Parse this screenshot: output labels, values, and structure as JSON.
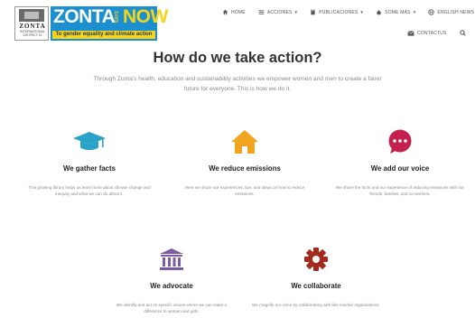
{
  "logo": {
    "org": "ZONTA",
    "sub": "INTERNATIONAL DISTRICT 13",
    "banner_zonta": "ZONTA",
    "banner_says": "SAYS",
    "banner_now": "NOW",
    "tagline": "To gender equality and climate action"
  },
  "nav": {
    "home": "HOME",
    "acciones": "ACCIONES",
    "publicaciones": "PUBLICACIONES",
    "some_mas": "SOME MÁS",
    "english": "ENGLISH NEWS",
    "contact": "CONTACTUS"
  },
  "main": {
    "title": "How do we take action?",
    "intro": "Through Zonta's health, education and sustainability activities we empower women and men to create a fairer future for everyone. This is how we do it."
  },
  "cards": [
    {
      "title": "We gather facts",
      "text": "This growing library helps us learn more about climate change and inequity and what we can do about it."
    },
    {
      "title": "We reduce emissions",
      "text": "Here we share our experiences, tips, and ideas on how to reduce emissions."
    },
    {
      "title": "We add our voice",
      "text": "We share the facts and our experience of reducing emissions with our friends, families, and co-workers."
    },
    {
      "title": "We advocate",
      "text": "We identify and act on specific issues where we can make a difference to women and girls."
    },
    {
      "title": "We collaborate",
      "text": "We magnify our voice by collaborating with like-minded organizations."
    }
  ],
  "colors": {
    "facts": "#2aa3c8",
    "emissions": "#f0a41f",
    "voice": "#c51f4d",
    "advocate": "#7b5aa6",
    "collaborate": "#a52a1e",
    "banner": "#1b8fd0",
    "banner_accent": "#f7d417"
  }
}
